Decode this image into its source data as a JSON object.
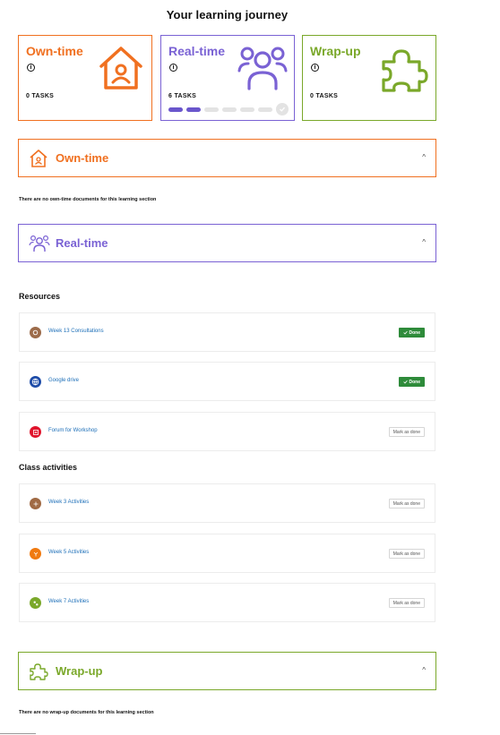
{
  "page": {
    "title": "Your learning journey"
  },
  "colors": {
    "own": "#f07020",
    "real": "#7a62d4",
    "wrap": "#7aa82a",
    "done": "#2e8b3a",
    "link": "#1d6fb8"
  },
  "cards": {
    "own": {
      "title": "Own-time",
      "tasks": "0 TASKS",
      "icon": "house-icon"
    },
    "real": {
      "title": "Real-time",
      "tasks": "6 TASKS",
      "icon": "people-icon",
      "progress_completed": 2,
      "progress_total": 6
    },
    "wrap": {
      "title": "Wrap-up",
      "tasks": "0 TASKS",
      "icon": "puzzle-icon"
    }
  },
  "sections": {
    "own": {
      "title": "Own-time",
      "empty_text": "There are no own-time documents for this learning section"
    },
    "real": {
      "title": "Real-time"
    },
    "wrap": {
      "title": "Wrap-up",
      "empty_text": "There are no wrap-up documents for this learning section"
    }
  },
  "resources": {
    "heading": "Resources",
    "items": [
      {
        "label": "Week 13 Consultations",
        "status": "Done",
        "icon": "consultation-icon"
      },
      {
        "label": "Google drive",
        "status": "Done",
        "icon": "globe-icon"
      },
      {
        "label": "Forum for Workshop",
        "status": "Mark as done",
        "icon": "forum-icon"
      }
    ]
  },
  "activities": {
    "heading": "Class activities",
    "items": [
      {
        "label": "Week 3 Activities",
        "status": "Mark as done",
        "icon": "activity-icon"
      },
      {
        "label": "Week 5 Activities",
        "status": "Mark as done",
        "icon": "activity-icon"
      },
      {
        "label": "Week 7 Activities",
        "status": "Mark as done",
        "icon": "activity-icon"
      }
    ]
  }
}
